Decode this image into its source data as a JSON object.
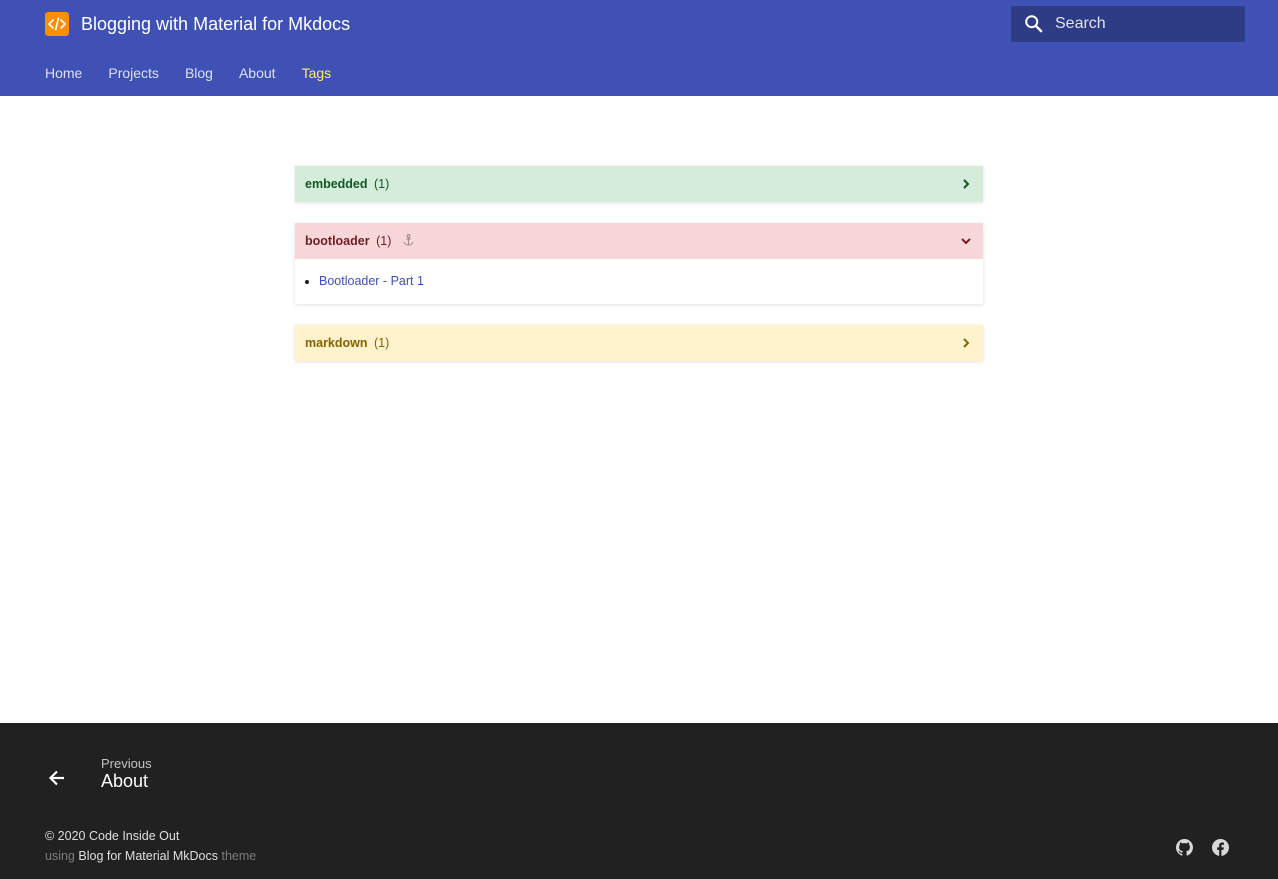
{
  "header": {
    "site_title": "Blogging with Material for Mkdocs",
    "logo_icon": "code-icon",
    "search_placeholder": "Search",
    "tabs": [
      {
        "label": "Home",
        "active": false
      },
      {
        "label": "Projects",
        "active": false
      },
      {
        "label": "Blog",
        "active": false
      },
      {
        "label": "About",
        "active": false
      },
      {
        "label": "Tags",
        "active": true
      }
    ]
  },
  "tags": [
    {
      "name": "embedded",
      "count": "(1)",
      "expanded": false,
      "color": "#d4edda",
      "posts": []
    },
    {
      "name": "bootloader",
      "count": "(1)",
      "expanded": true,
      "color": "#f8d7da",
      "posts": [
        "Bootloader - Part 1"
      ]
    },
    {
      "name": "markdown",
      "count": "(1)",
      "expanded": false,
      "color": "#fff3cd",
      "posts": []
    }
  ],
  "footer": {
    "previous_caption": "Previous",
    "previous_title": "About",
    "copyright": "© 2020 Code Inside Out",
    "credit_prefix": "using",
    "credit_link": "Blog for Material MkDocs",
    "credit_suffix": "theme",
    "social_icons": [
      "github-icon",
      "facebook-icon"
    ]
  },
  "colors": {
    "primary": "#3f51b5",
    "accent_tab": "#ffee58",
    "logo_bg": "#ff8f00",
    "footer_bg": "#212121"
  }
}
